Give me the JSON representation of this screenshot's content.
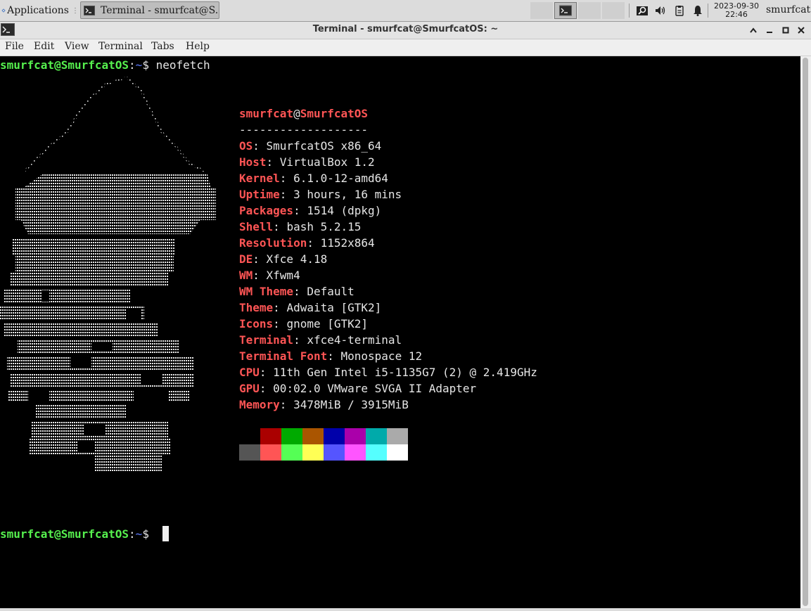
{
  "panel": {
    "applications_label": "Applications",
    "task_label": "Terminal - smurfcat@S...",
    "clock_date": "2023-09-30",
    "clock_time": "22:46",
    "user": "smurfcat"
  },
  "window": {
    "title": "Terminal - smurfcat@SmurfcatOS: ~",
    "buttons": [
      "maximize-up",
      "minimize",
      "maximize",
      "close"
    ]
  },
  "menu": [
    "File",
    "Edit",
    "View",
    "Terminal",
    "Tabs",
    "Help"
  ],
  "terminal": {
    "prompt_user": "smurfcat@SmurfcatOS",
    "prompt_sep": ":",
    "prompt_path": "~",
    "prompt_dollar": "$ ",
    "command": "neofetch",
    "header_user": "smurfcat",
    "header_at": "@",
    "header_host": "SmurfcatOS",
    "divider": "-------------------",
    "info": [
      {
        "key": "OS",
        "value": "SmurfcatOS x86_64"
      },
      {
        "key": "Host",
        "value": "VirtualBox 1.2"
      },
      {
        "key": "Kernel",
        "value": "6.1.0-12-amd64"
      },
      {
        "key": "Uptime",
        "value": "3 hours, 16 mins"
      },
      {
        "key": "Packages",
        "value": "1514 (dpkg)"
      },
      {
        "key": "Shell",
        "value": "bash 5.2.15"
      },
      {
        "key": "Resolution",
        "value": "1152x864"
      },
      {
        "key": "DE",
        "value": "Xfce 4.18"
      },
      {
        "key": "WM",
        "value": "Xfwm4"
      },
      {
        "key": "WM Theme",
        "value": "Default"
      },
      {
        "key": "Theme",
        "value": "Adwaita [GTK2]"
      },
      {
        "key": "Icons",
        "value": "gnome [GTK2]"
      },
      {
        "key": "Terminal",
        "value": "xfce4-terminal"
      },
      {
        "key": "Terminal Font",
        "value": "Monospace 12"
      },
      {
        "key": "CPU",
        "value": "11th Gen Intel i5-1135G7 (2) @ 2.419GHz"
      },
      {
        "key": "GPU",
        "value": "00:02.0 VMware SVGA II Adapter"
      },
      {
        "key": "Memory",
        "value": "3478MiB / 3915MiB"
      }
    ],
    "palette_top": [
      "#000000",
      "#aa0000",
      "#00aa00",
      "#aa5500",
      "#0000aa",
      "#aa00aa",
      "#00aaaa",
      "#aaaaaa"
    ],
    "palette_bottom": [
      "#555555",
      "#ff5555",
      "#55ff55",
      "#ffff55",
      "#5555ff",
      "#ff55ff",
      "#55ffff",
      "#ffffff"
    ]
  }
}
